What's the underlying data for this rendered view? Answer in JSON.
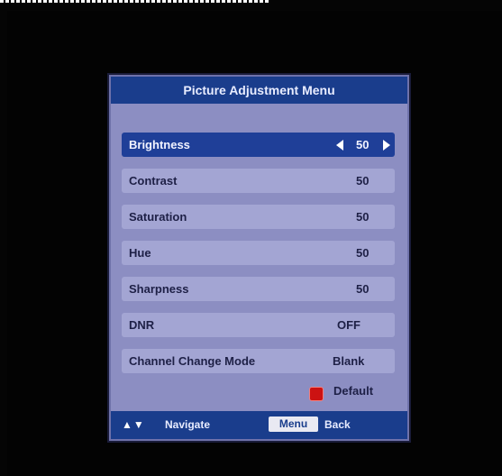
{
  "menu": {
    "title": "Picture Adjustment Menu",
    "items": [
      {
        "label": "Brightness",
        "value": "50"
      },
      {
        "label": "Contrast",
        "value": "50"
      },
      {
        "label": "Saturation",
        "value": "50"
      },
      {
        "label": "Hue",
        "value": "50"
      },
      {
        "label": "Sharpness",
        "value": "50"
      },
      {
        "label": "DNR",
        "value": "OFF"
      },
      {
        "label": "Channel Change Mode",
        "value": "Blank"
      }
    ],
    "selected_index": 0,
    "default_label": "Default",
    "default_color": "#cc1212"
  },
  "footer": {
    "navigate_icon": "up-down-arrows-icon",
    "navigate_label": "Navigate",
    "menu_key": "Menu",
    "back_label": "Back"
  },
  "colors": {
    "panel": "#8c8ec2",
    "header": "#1a3d8c",
    "selected_row": "#1f3f98",
    "row": "#a3a5d3"
  }
}
